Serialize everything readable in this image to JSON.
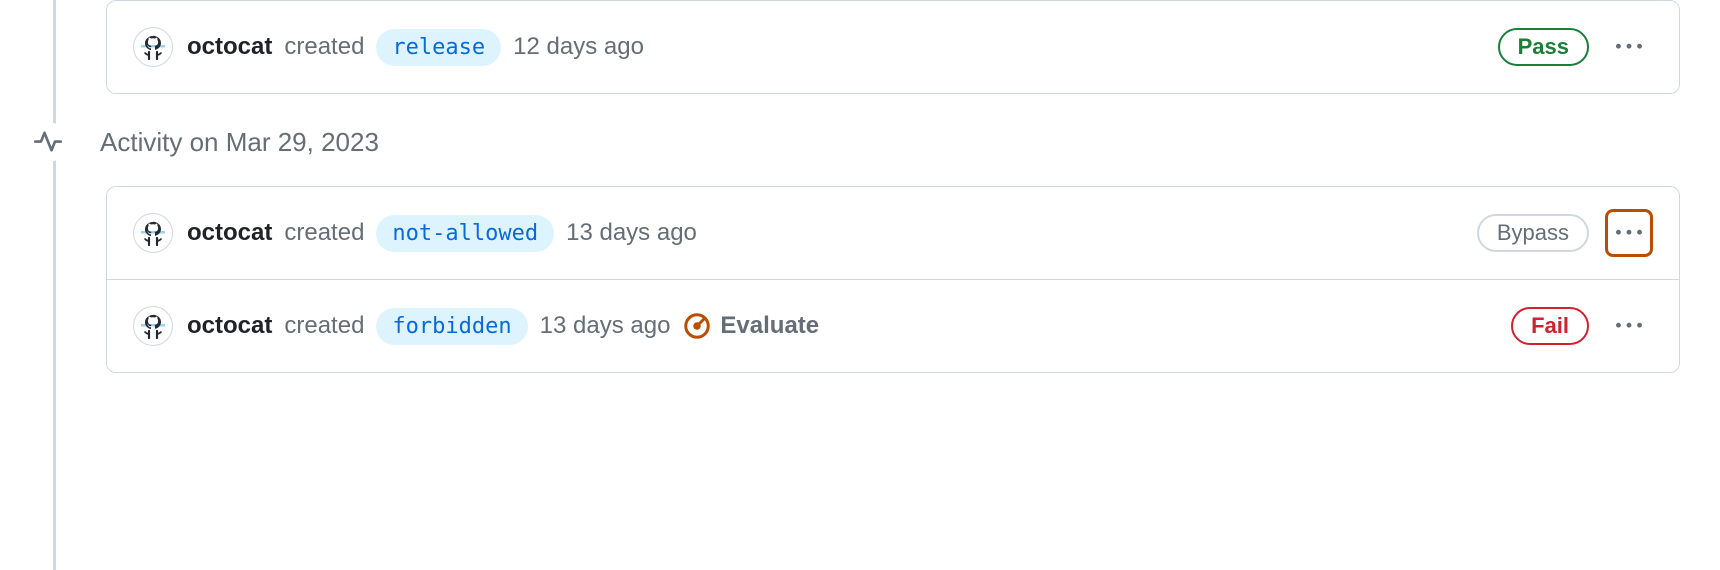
{
  "days": [
    {
      "header_label": "",
      "show_header": false,
      "items": [
        {
          "username": "octocat",
          "action": "created",
          "tag": "release",
          "time": "12 days ago",
          "evaluate_label": "",
          "show_evaluate": false,
          "status_label": "Pass",
          "status_class": "status-pass",
          "kebab_highlighted": false
        }
      ]
    },
    {
      "header_label": "Activity on Mar 29, 2023",
      "show_header": true,
      "items": [
        {
          "username": "octocat",
          "action": "created",
          "tag": "not-allowed",
          "time": "13 days ago",
          "evaluate_label": "",
          "show_evaluate": false,
          "status_label": "Bypass",
          "status_class": "status-bypass",
          "kebab_highlighted": true
        },
        {
          "username": "octocat",
          "action": "created",
          "tag": "forbidden",
          "time": "13 days ago",
          "evaluate_label": "Evaluate",
          "show_evaluate": true,
          "status_label": "Fail",
          "status_class": "status-fail",
          "kebab_highlighted": false
        }
      ]
    }
  ]
}
